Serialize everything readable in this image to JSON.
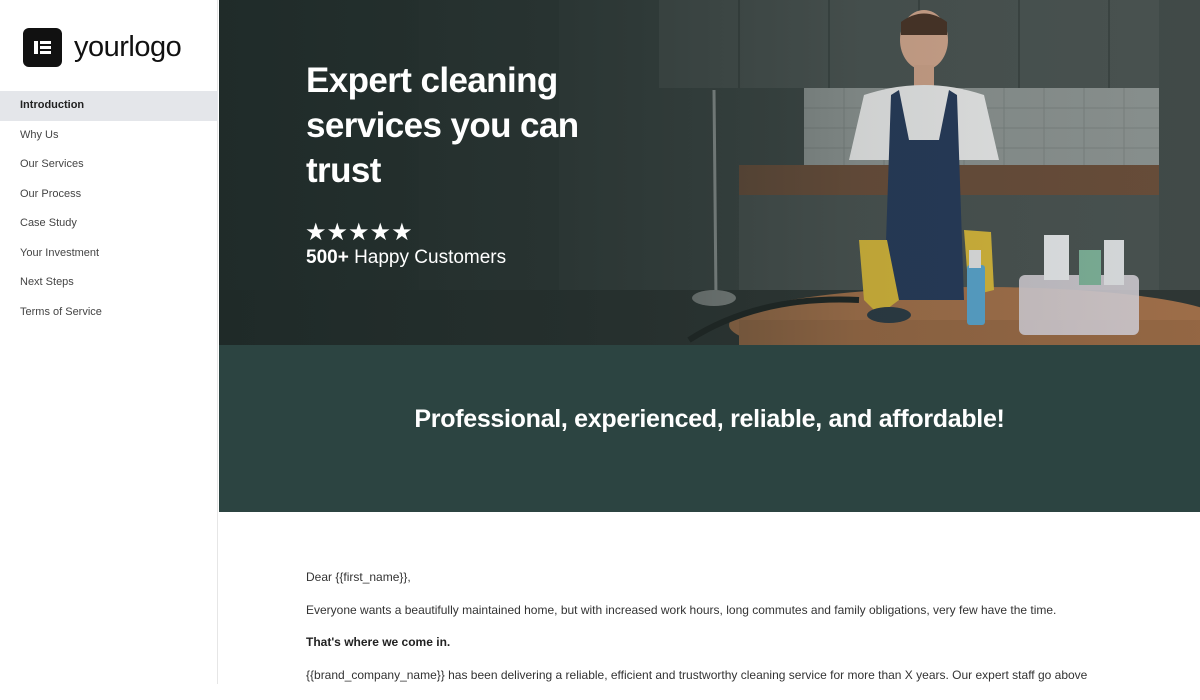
{
  "logo": {
    "text": "yourlogo"
  },
  "sidebar": {
    "items": [
      {
        "label": "Introduction",
        "active": true
      },
      {
        "label": "Why Us"
      },
      {
        "label": "Our Services"
      },
      {
        "label": "Our Process"
      },
      {
        "label": "Case Study"
      },
      {
        "label": "Your Investment"
      },
      {
        "label": "Next Steps"
      },
      {
        "label": "Terms of Service"
      }
    ]
  },
  "hero": {
    "title": "Expert cleaning services you can trust",
    "stars": "★★★★★",
    "rating_count": "500+",
    "rating_text": "Happy Customers"
  },
  "banner": {
    "text": "Professional, experienced, reliable, and affordable!"
  },
  "letter": {
    "greeting": "Dear {{first_name}},",
    "paragraph1": "Everyone wants a beautifully maintained home, but with increased work hours, long commutes and family obligations, very few have the time.",
    "bold_line": "That's where we come in.",
    "paragraph2": "{{brand_company_name}} has been delivering a reliable, efficient and trustworthy cleaning service for more than X years. Our expert staff go above"
  },
  "colors": {
    "banner": "#2c4441",
    "active_nav": "#e4e6ea",
    "hero_dark": "#3a4442"
  }
}
